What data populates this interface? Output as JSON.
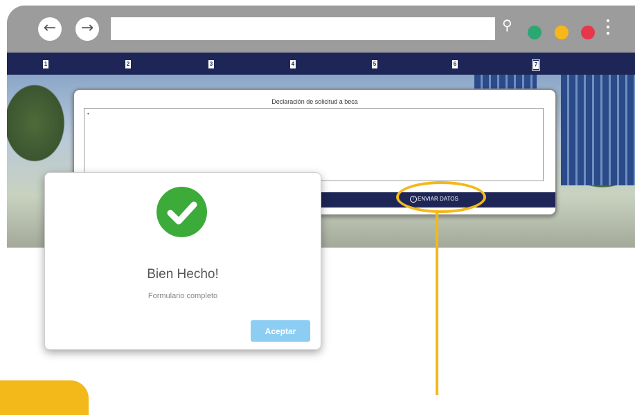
{
  "browser": {
    "back_icon": "arrow-left-icon",
    "forward_icon": "arrow-right-icon",
    "back_glyph": "←",
    "forward_glyph": "→",
    "search_glyph": "⚲",
    "url": "",
    "window_dots": [
      "#2aa872",
      "#f6b71b",
      "#e8364b"
    ]
  },
  "steps": [
    "1",
    "2",
    "3",
    "4",
    "5",
    "6",
    "7"
  ],
  "form": {
    "title": "Declaración de solicitud a beca",
    "textarea_value": "",
    "submit_label": "ENVIAR DATOS"
  },
  "dialog": {
    "title": "Bien Hecho!",
    "message": "Formulario completo",
    "accept_label": "Aceptar"
  },
  "colors": {
    "nav_bar": "#1d2656",
    "success": "#3cab3a",
    "accent_highlight": "#f3b81a",
    "accept_button": "#8ccdf3"
  }
}
